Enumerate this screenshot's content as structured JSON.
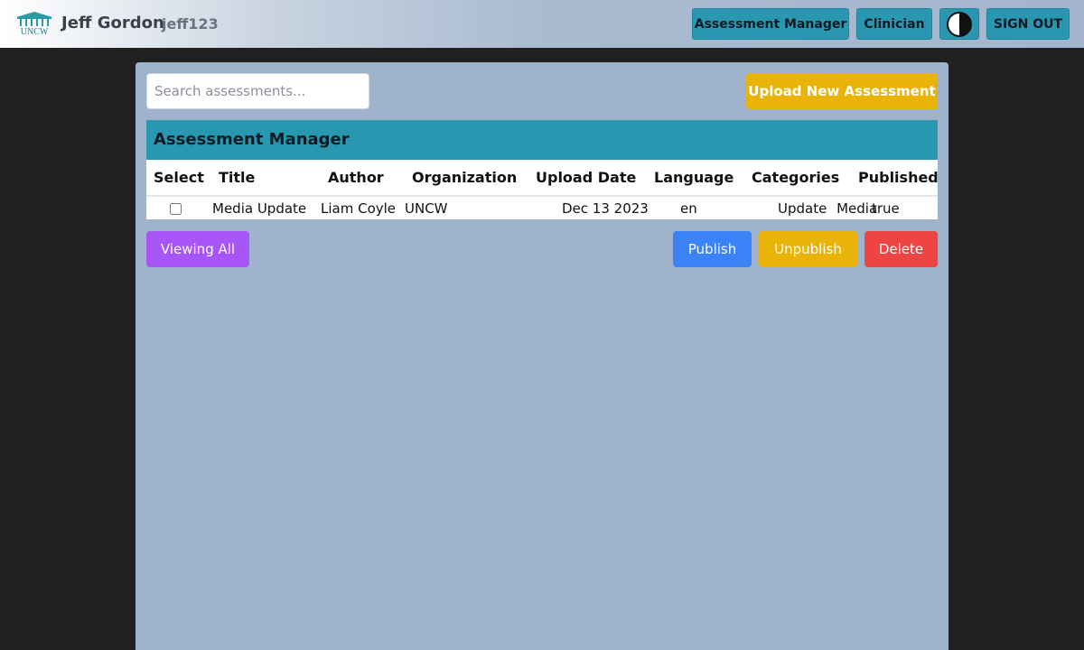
{
  "header": {
    "logo_text": "UNCW",
    "user_name": "Jeff Gordon",
    "user_handle": "jeff123",
    "nav": {
      "assessment_manager": "Assessment Manager",
      "clinician": "Clinician",
      "sign_out": "SIGN OUT"
    }
  },
  "toolbar": {
    "search_placeholder": "Search assessments...",
    "upload_label": "Upload New Assessment"
  },
  "table": {
    "title": "Assessment Manager",
    "columns": [
      "Select",
      "Title",
      "Author",
      "Organization",
      "Upload Date",
      "Language",
      "Categories",
      "Published"
    ],
    "rows": [
      {
        "selected": false,
        "title": "Media Update",
        "author": "Liam Coyle",
        "organization": "UNCW",
        "upload_date": "Dec 13 2023",
        "language": "en",
        "categories": [
          "Update",
          "Media"
        ],
        "published": "true"
      }
    ]
  },
  "actions": {
    "view_label": "Viewing All",
    "publish_label": "Publish",
    "unpublish_label": "Unpublish",
    "delete_label": "Delete"
  },
  "colors": {
    "accent_teal": "#2a97b0",
    "panel": "#9fb4cc",
    "yellow": "#eab308",
    "purple": "#a855f7",
    "blue": "#3b82f6",
    "red": "#ef4444"
  }
}
